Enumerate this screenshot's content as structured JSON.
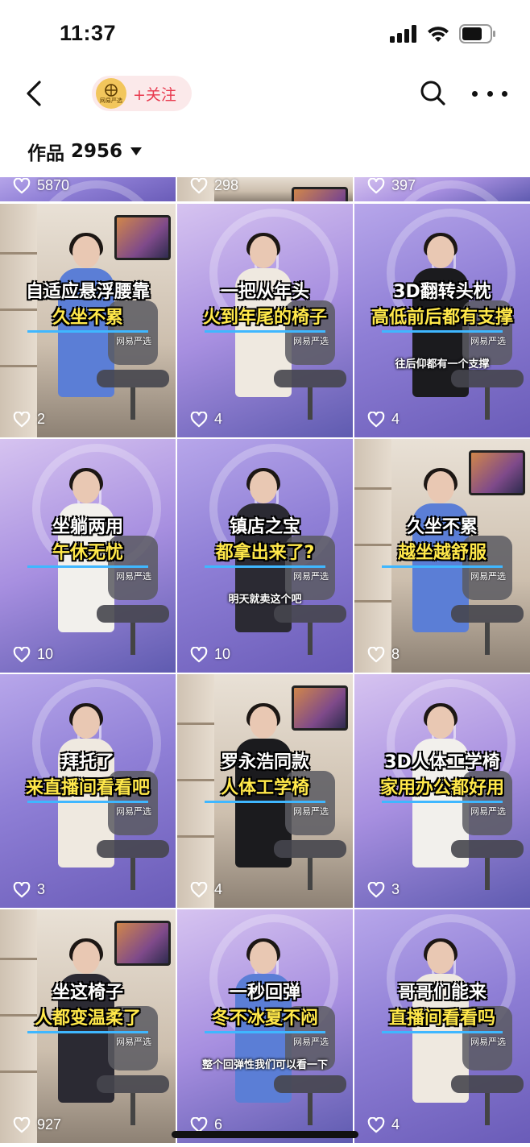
{
  "status_bar": {
    "time": "11:37"
  },
  "header": {
    "avatar_text": "网易严选",
    "follow_label": "+关注"
  },
  "works": {
    "label": "作品",
    "count": "2956"
  },
  "tiles": [
    {
      "likes": "5870",
      "cap1": "",
      "cap2": "",
      "sub": ""
    },
    {
      "likes": "298",
      "cap1": "",
      "cap2": "",
      "sub": ""
    },
    {
      "likes": "397",
      "cap1": "",
      "cap2": "",
      "sub": ""
    },
    {
      "likes": "2",
      "cap1": "自适应悬浮腰靠",
      "cap2": "久坐不累",
      "brand": "网易严选",
      "sub": ""
    },
    {
      "likes": "4",
      "cap1": "一把从年头",
      "cap2": "火到年尾的椅子",
      "brand": "网易严选",
      "sub": ""
    },
    {
      "likes": "4",
      "cap1": "3D翻转头枕",
      "cap2": "高低前后都有支撑",
      "brand": "网易严选",
      "sub": "往后仰都有一个支撑"
    },
    {
      "likes": "10",
      "cap1": "坐躺两用",
      "cap2": "午休无忧",
      "brand": "网易严选",
      "sub": ""
    },
    {
      "likes": "10",
      "cap1": "镇店之宝",
      "cap2": "都拿出来了?",
      "brand": "网易严选",
      "sub": "明天就卖这个吧"
    },
    {
      "likes": "8",
      "cap1": "久坐不累",
      "cap2": "越坐越舒服",
      "brand": "网易严选",
      "sub": ""
    },
    {
      "likes": "3",
      "cap1": "拜托了",
      "cap2": "来直播间看看吧",
      "brand": "网易严选",
      "sub": ""
    },
    {
      "likes": "4",
      "cap1": "罗永浩同款",
      "cap2": "人体工学椅",
      "brand": "网易严选",
      "sub": ""
    },
    {
      "likes": "3",
      "cap1": "3D人体工学椅",
      "cap2": "家用办公都好用",
      "brand": "网易严选",
      "sub": ""
    },
    {
      "likes": "927",
      "cap1": "坐这椅子",
      "cap2": "人都变温柔了",
      "brand": "网易严选",
      "sub": ""
    },
    {
      "likes": "6",
      "cap1": "一秒回弹",
      "cap2": "冬不冰夏不闷",
      "brand": "网易严选",
      "sub": "整个回弹性我们可以看一下"
    },
    {
      "likes": "4",
      "cap1": "哥哥们能来",
      "cap2": "直播间看看吗",
      "brand": "网易严选",
      "sub": ""
    }
  ],
  "colors": {
    "accent_red": "#e8384d",
    "follow_bg": "#fbe9ea",
    "caption_yellow": "#ffe84a",
    "studio_purple": "#8f7fd6",
    "office_beige": "#d9cbb9"
  },
  "icons": [
    "back-chevron-icon",
    "search-icon",
    "more-dots-icon",
    "heart-icon",
    "signal-icon",
    "wifi-icon",
    "battery-icon"
  ]
}
